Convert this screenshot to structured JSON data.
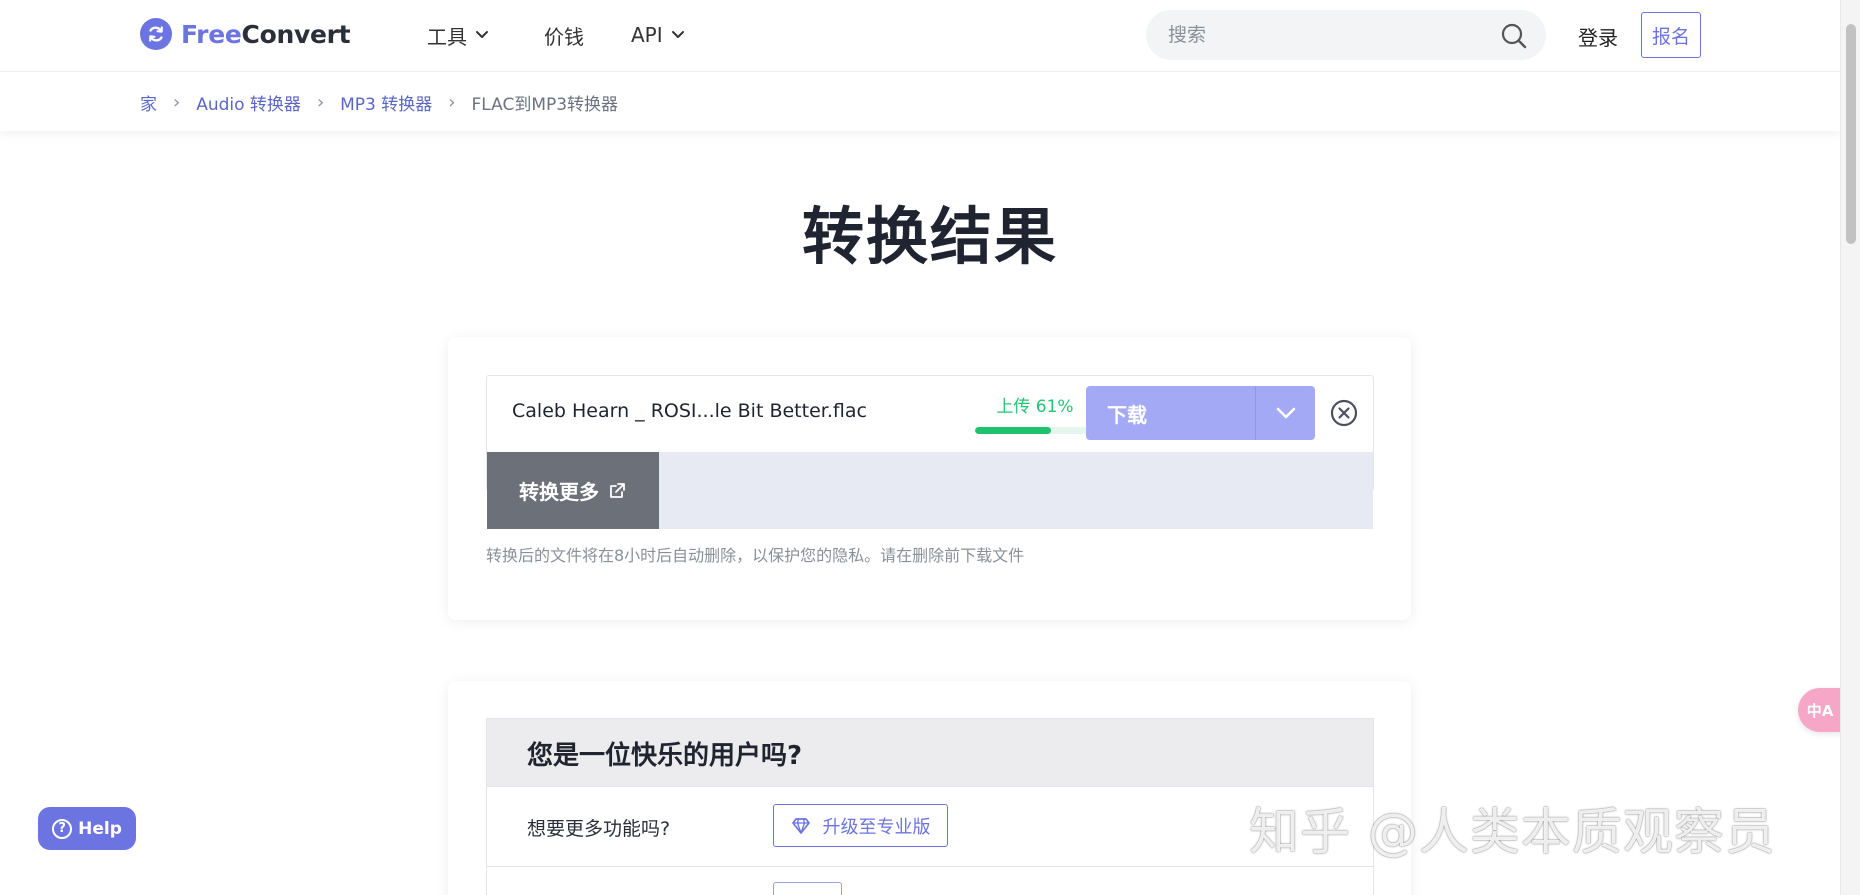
{
  "header": {
    "logo_free": "Free",
    "logo_convert": "Convert",
    "nav": {
      "tools_label": "工具",
      "pricing_label": "价钱",
      "api_label": "API"
    },
    "search_placeholder": "搜索",
    "login_label": "登录",
    "signup_label": "报名"
  },
  "breadcrumb": {
    "items": [
      "家",
      "Audio 转换器",
      "MP3 转换器",
      "FLAC到MP3转换器"
    ]
  },
  "page_title": "转换结果",
  "result": {
    "file_name": "Caleb Hearn _ ROSI...le Bit Better.flac",
    "upload_status": "上传 61%",
    "upload_progress": 0.61,
    "download_label": "下载",
    "convert_more_label": "转换更多",
    "privacy_note": "转换后的文件将在8小时后自动删除，以保护您的隐私。请在删除前下载文件"
  },
  "happy": {
    "title": "您是一位快乐的用户吗?",
    "row_label": "想要更多功能吗?",
    "upgrade_label": "升级至专业版"
  },
  "help_label": "Help",
  "translate_label": "中A",
  "watermark": "知乎 @人类本质观察员",
  "colors": {
    "brand": "#6b74e0",
    "download_button": "#a3a9f4",
    "progress": "#1ec26d",
    "convert_more_button": "#6b7079"
  }
}
